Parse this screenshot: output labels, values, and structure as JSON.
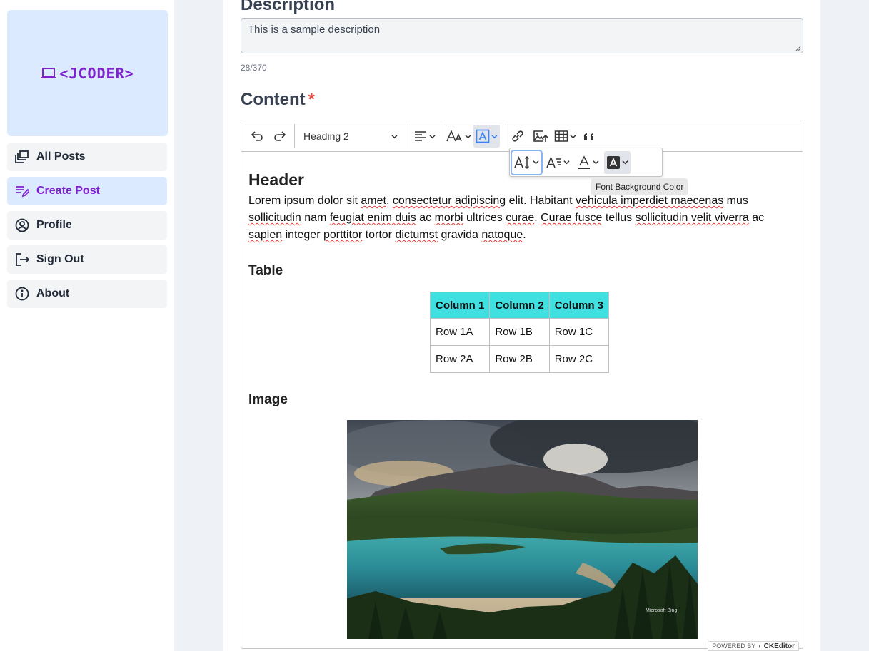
{
  "brand": {
    "logo_text": "<JCODER>",
    "accent": "#7e22ce"
  },
  "sidebar": {
    "items": [
      {
        "label": "All Posts",
        "icon": "stack-icon",
        "active": false
      },
      {
        "label": "Create Post",
        "icon": "edit-list-icon",
        "active": true
      },
      {
        "label": "Profile",
        "icon": "user-circle-icon",
        "active": false
      },
      {
        "label": "Sign Out",
        "icon": "sign-out-icon",
        "active": false
      },
      {
        "label": "About",
        "icon": "info-icon",
        "active": false
      }
    ]
  },
  "form": {
    "description_label": "Description",
    "description_value": "This is a sample description",
    "char_count": "28/370",
    "content_label": "Content",
    "required_mark": "*"
  },
  "editor": {
    "heading_select": "Heading 2",
    "tooltip": "Font Background Color",
    "badge_prefix": "POWERED BY",
    "badge_brand": "CKEditor",
    "doc": {
      "header": "Header",
      "paragraph": {
        "p1": "Lorem ipsum dolor sit ",
        "w1": "amet",
        "p2": ", ",
        "w2": "consectetur adipiscing",
        "p3": " elit. Habitant ",
        "w3": "vehicula imperdiet maecenas",
        "p4": " mus ",
        "w4": "sollicitudin",
        "p5": " nam ",
        "w5": "feugiat enim duis",
        "p6": " ac ",
        "w6": "morbi",
        "p7": " ultrices ",
        "w7": "curae",
        "p8": ". ",
        "w8": "Curae fusce",
        "p9": " tellus ",
        "w9": "sollicitudin velit viverra",
        "p10": " ac ",
        "w10": "sapien",
        "p11": " integer ",
        "w11": "porttitor",
        "p12": " tortor ",
        "w12": "dictumst",
        "p13": " gravida ",
        "w13": "natoque",
        "p14": "."
      },
      "table_heading": "Table",
      "table": {
        "headers": [
          "Column 1",
          "Column 2",
          "Column 3"
        ],
        "rows": [
          [
            "Row 1A",
            "Row 1B",
            "Row 1C"
          ],
          [
            "Row 2A",
            "Row 2B",
            "Row 2C"
          ]
        ],
        "header_color": "#40e0e0"
      },
      "image_heading": "Image",
      "image_watermark": "Microsoft Bing"
    }
  }
}
